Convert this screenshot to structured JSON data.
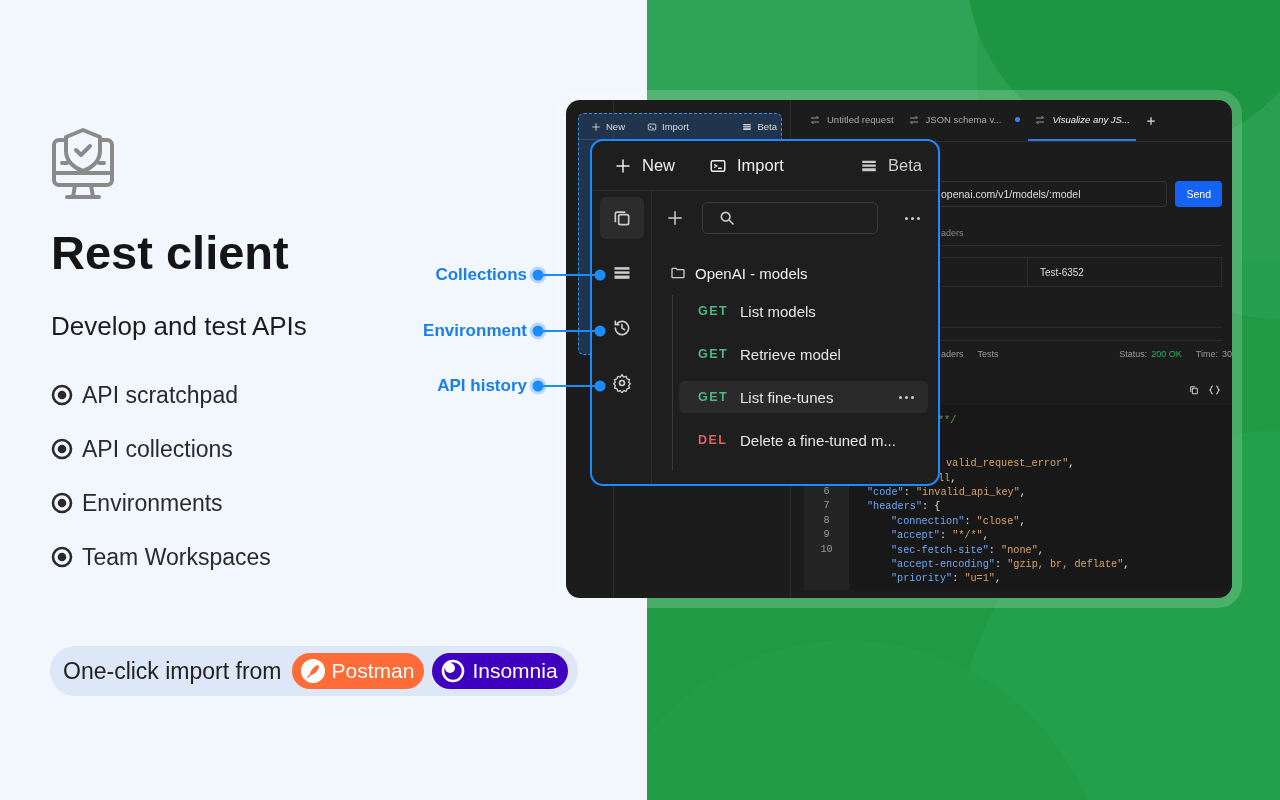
{
  "intro": {
    "title": "Rest client",
    "subtitle": "Develop and test APIs",
    "features": [
      "API scratchpad",
      "API collections",
      "Environments",
      "Team Workspaces"
    ],
    "import": {
      "label": "One-click import from",
      "sources": [
        {
          "name": "Postman",
          "color": "#ff6c37",
          "kind": "rocket"
        },
        {
          "name": "Insomnia",
          "color": "#4000bf",
          "kind": "ring"
        }
      ]
    }
  },
  "callouts": [
    "Collections",
    "Environment",
    "API history"
  ],
  "window": {
    "sidebar_toolbar": [
      "New",
      "Import",
      "Beta"
    ],
    "tabs": [
      {
        "label": "Untitled request",
        "selected": false,
        "modified": false
      },
      {
        "label": "JSON schema v...",
        "selected": false,
        "modified": true
      },
      {
        "label": "Visualize any JS...",
        "selected": true,
        "modified": false
      }
    ],
    "url": "openai.com/v1/models/:model",
    "send": "Send",
    "request_tab": "aders",
    "param_value": "Test-6352",
    "response_tabs": [
      "aders",
      "Tests"
    ],
    "status_label": "Status:",
    "status": "200 OK",
    "time_label": "Time:",
    "time": "30",
    "code": {
      "fragments": [
        {
          "segments": [
            {
              "kind": "comment",
              "text": "**/"
            }
          ]
        },
        {
          "segments": [
            {
              "kind": "string",
              "text": "valid_request_error\""
            },
            {
              "kind": "punct",
              "text": ","
            }
          ]
        },
        {
          "segments": [
            {
              "kind": "string",
              "text": "ll"
            },
            {
              "kind": "punct",
              "text": ","
            }
          ]
        }
      ],
      "lines": [
        {
          "number": "6",
          "segments": [
            {
              "kind": "key",
              "text": "\"code\""
            },
            {
              "kind": "punct",
              "text": ": "
            },
            {
              "kind": "string",
              "text": "\"invalid_api_key\""
            },
            {
              "kind": "punct",
              "text": ","
            }
          ]
        },
        {
          "number": "7",
          "segments": [
            {
              "kind": "key",
              "text": "\"headers\""
            },
            {
              "kind": "punct",
              "text": ": {"
            }
          ],
          "children": [
            {
              "number": "8",
              "segments": [
                {
                  "kind": "key",
                  "text": "\"connection\""
                },
                {
                  "kind": "punct",
                  "text": ": "
                },
                {
                  "kind": "string",
                  "text": "\"close\""
                },
                {
                  "kind": "punct",
                  "text": ","
                }
              ]
            },
            {
              "number": "9",
              "segments": [
                {
                  "kind": "key",
                  "text": "\"accept\""
                },
                {
                  "kind": "punct",
                  "text": ": "
                },
                {
                  "kind": "string",
                  "text": "\"*/*\""
                },
                {
                  "kind": "punct",
                  "text": ","
                }
              ]
            },
            {
              "number": "10",
              "segments": [
                {
                  "kind": "key",
                  "text": "\"sec-fetch-site\""
                },
                {
                  "kind": "punct",
                  "text": ": "
                },
                {
                  "kind": "string",
                  "text": "\"none\""
                },
                {
                  "kind": "punct",
                  "text": ","
                }
              ]
            },
            {
              "segments": [
                {
                  "kind": "key",
                  "text": "\"accept-encoding\""
                },
                {
                  "kind": "punct",
                  "text": ": "
                },
                {
                  "kind": "string",
                  "text": "\"gzip, br, deflate\""
                },
                {
                  "kind": "punct",
                  "text": ","
                }
              ]
            },
            {
              "segments": [
                {
                  "kind": "key",
                  "text": "\"priority\""
                },
                {
                  "kind": "punct",
                  "text": ": "
                },
                {
                  "kind": "string",
                  "text": "\"u=1\""
                },
                {
                  "kind": "punct",
                  "text": ","
                }
              ]
            }
          ]
        }
      ]
    }
  },
  "popup": {
    "toolbar": [
      "New",
      "Import",
      "Beta"
    ],
    "rail": [
      {
        "selected": true
      },
      {
        "selected": false
      },
      {
        "selected": false
      },
      {
        "selected": false
      }
    ],
    "folder": "OpenAI - models",
    "requests": [
      {
        "method": "GET",
        "name": "List models",
        "color": "#4fb883",
        "selected": false
      },
      {
        "method": "GET",
        "name": "Retrieve model",
        "color": "#4fb883",
        "selected": false
      },
      {
        "method": "GET",
        "name": "List fine-tunes",
        "color": "#4fb883",
        "selected": true
      },
      {
        "method": "DEL",
        "name": "Delete a fine-tuned m...",
        "color": "#e0605f",
        "selected": false
      }
    ]
  }
}
